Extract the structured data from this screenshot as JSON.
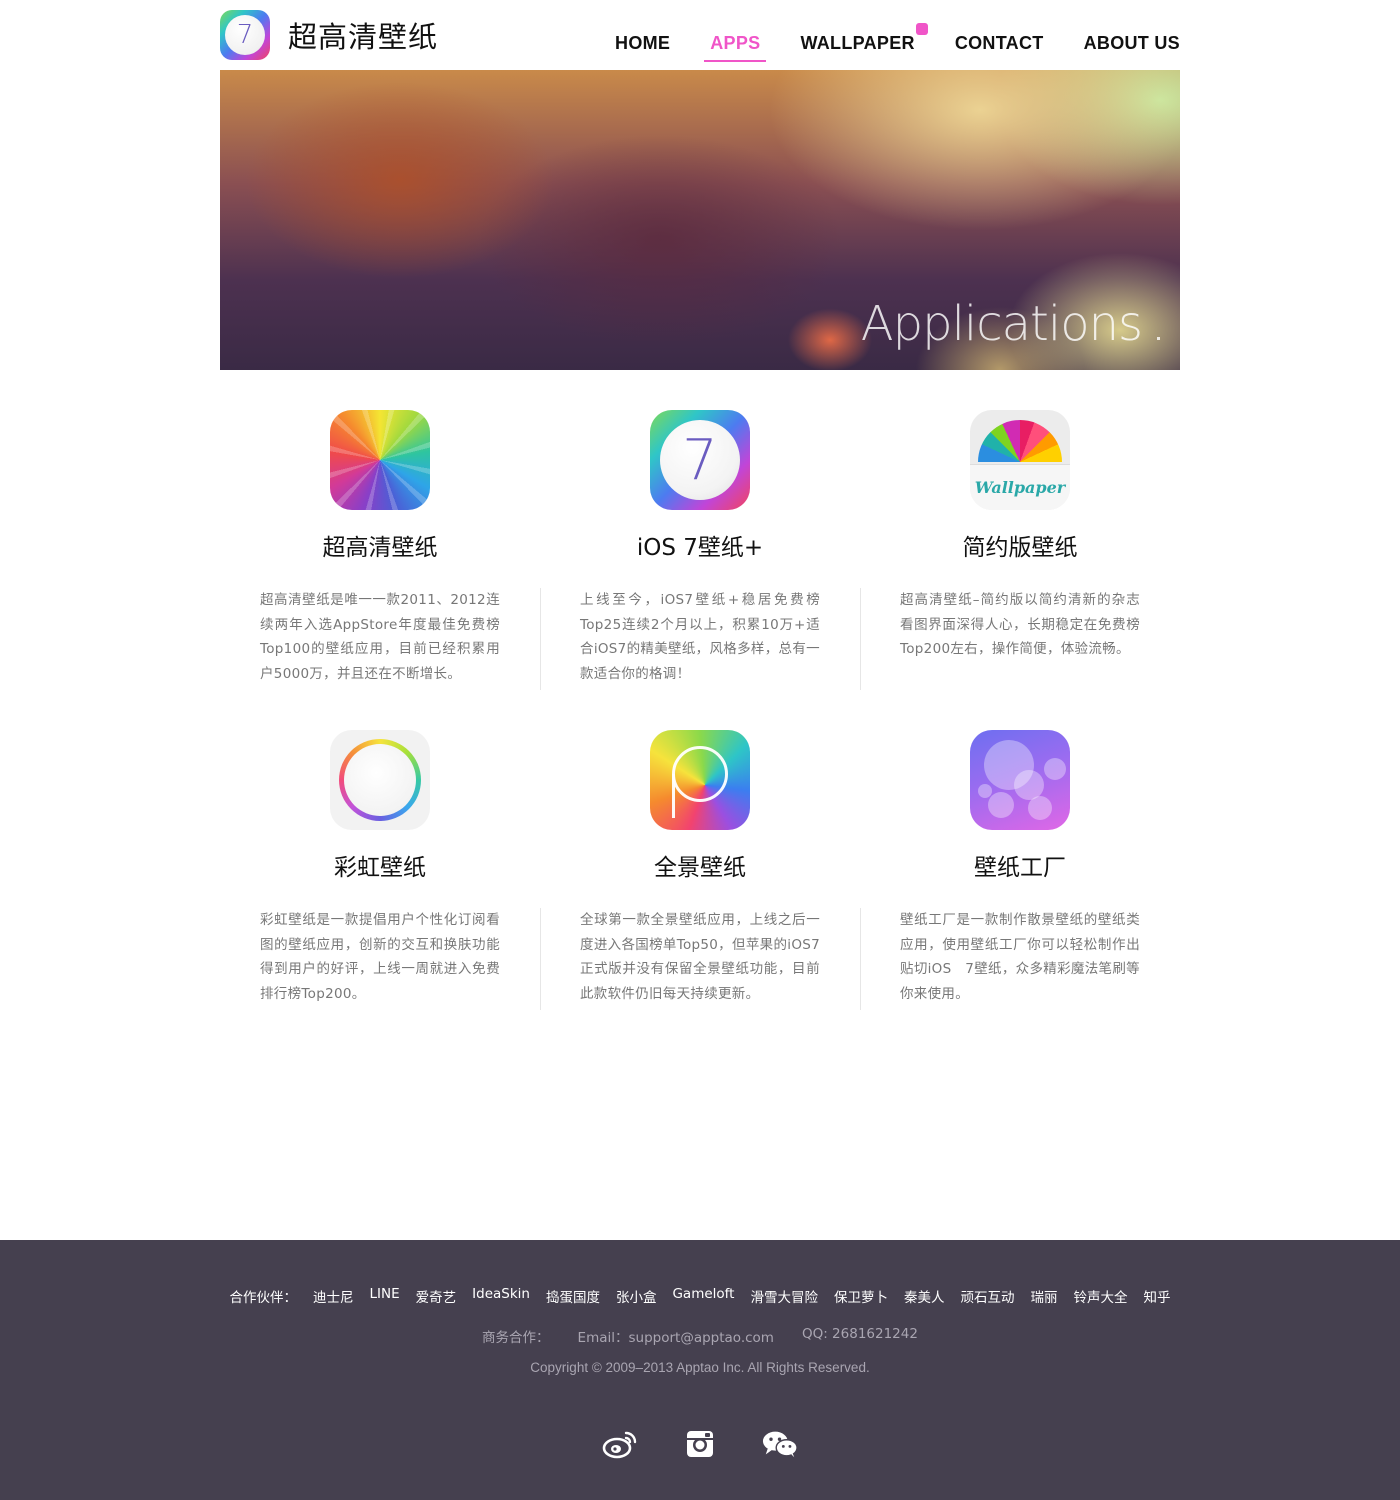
{
  "brand": {
    "logo_numeral": "7",
    "title": "超高清壁纸"
  },
  "nav": {
    "items": [
      "HOME",
      "APPS",
      "WALLPAPER",
      "CONTACT",
      "ABOUT US"
    ],
    "active": "APPS"
  },
  "banner": {
    "text": "Applications"
  },
  "apps": [
    {
      "name": "超高清壁纸",
      "desc": "超高清壁纸是唯一一款2011、2012连续两年入选AppStore年度最佳免费榜Top100的壁纸应用，目前已经积累用户5000万，并且还在不断增长。"
    },
    {
      "name": "iOS 7壁纸+",
      "desc": "上线至今，iOS7壁纸+稳居免费榜Top25连续2个月以上，积累10万+适合iOS7的精美壁纸，风格多样，总有一款适合你的格调！",
      "icon_numeral": "7"
    },
    {
      "name": "简约版壁纸",
      "desc": "超高清壁纸–简约版以简约清新的杂志看图界面深得人心，长期稳定在免费榜Top200左右，操作简便，体验流畅。",
      "icon_label": "Wallpaper"
    },
    {
      "name": "彩虹壁纸",
      "desc": "彩虹壁纸是一款提倡用户个性化订阅看图的壁纸应用，创新的交互和换肤功能得到用户的好评，上线一周就进入免费排行榜Top200。"
    },
    {
      "name": "全景壁纸",
      "desc": "全球第一款全景壁纸应用，上线之后一度进入各国榜单Top50，但苹果的iOS7正式版并没有保留全景壁纸功能，目前此款软件仍旧每天持续更新。"
    },
    {
      "name": "壁纸工厂",
      "desc": "壁纸工厂是一款制作散景壁纸的壁纸类应用，使用壁纸工厂你可以轻松制作出贴切iOS　7壁纸，众多精彩魔法笔刷等你来使用。"
    }
  ],
  "footer": {
    "partners_label": "合作伙伴：",
    "partners": [
      "迪士尼",
      "LINE",
      "爱奇艺",
      "IdeaSkin",
      "捣蛋国度",
      "张小盒",
      "Gameloft",
      "滑雪大冒险",
      "保卫萝卜",
      "秦美人",
      "顽石互动",
      "瑞丽",
      "铃声大全",
      "知乎"
    ],
    "biz_label": "商务合作：",
    "email": "Email：support@apptao.com",
    "qq": "QQ: 2681621242",
    "copyright": "Copyright © 2009–2013 Apptao Inc. All Rights Reserved.",
    "social_icons": [
      "weibo-icon",
      "instagram-icon",
      "wechat-icon"
    ]
  },
  "colors": {
    "accent": "#f055c8",
    "footer_bg": "#45404f",
    "text_muted": "#777777"
  }
}
